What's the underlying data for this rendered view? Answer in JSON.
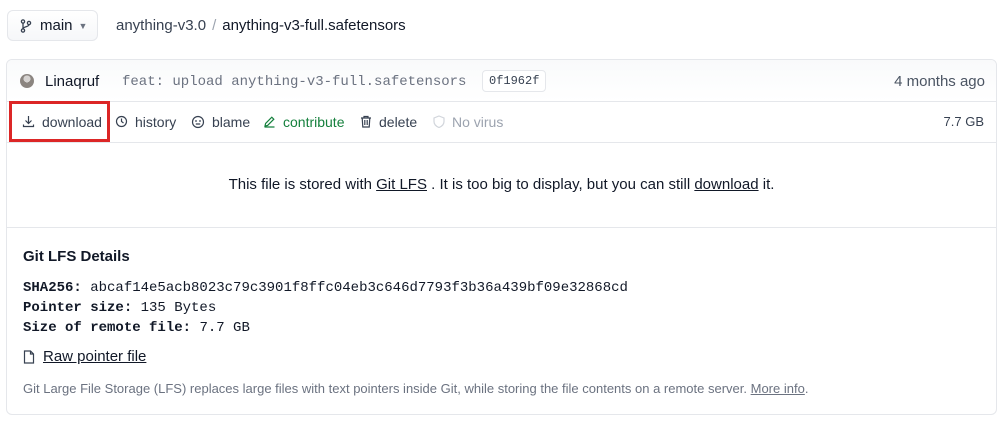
{
  "branch": {
    "name": "main"
  },
  "breadcrumb": {
    "repo": "anything-v3.0",
    "separator": "/",
    "file": "anything-v3-full.safetensors"
  },
  "commit": {
    "author": "Linaqruf",
    "message": "feat: upload anything-v3-full.safetensors",
    "hash": "0f1962f",
    "time": "4 months ago"
  },
  "actions": {
    "download": "download",
    "history": "history",
    "blame": "blame",
    "contribute": "contribute",
    "delete": "delete",
    "virus": "No virus",
    "size": "7.7 GB"
  },
  "lfs_message": {
    "before": "This file is stored with ",
    "link": "Git LFS",
    "middle": " . It is too big to display, but you can still ",
    "download_link": "download",
    "after": " it."
  },
  "details": {
    "title": "Git LFS Details",
    "sha_label": "SHA256:",
    "sha_value": "abcaf14e5acb8023c79c3901f8ffc04eb3c646d7793f3b36a439bf09e32868cd",
    "pointer_label": "Pointer size:",
    "pointer_value": "135 Bytes",
    "remote_label": "Size of remote file:",
    "remote_value": "7.7 GB",
    "raw_link": "Raw pointer file",
    "footer_text": "Git Large File Storage (LFS) replaces large files with text pointers inside Git, while storing the file contents on a remote server. ",
    "footer_link": "More info",
    "footer_end": "."
  },
  "colors": {
    "highlight_border": "#dc2626",
    "contribute": "#15803d"
  },
  "icons": [
    "branch-icon",
    "chevron-down-icon",
    "download-icon",
    "history-icon",
    "blame-icon",
    "pencil-icon",
    "trash-icon",
    "shield-icon",
    "file-icon"
  ]
}
